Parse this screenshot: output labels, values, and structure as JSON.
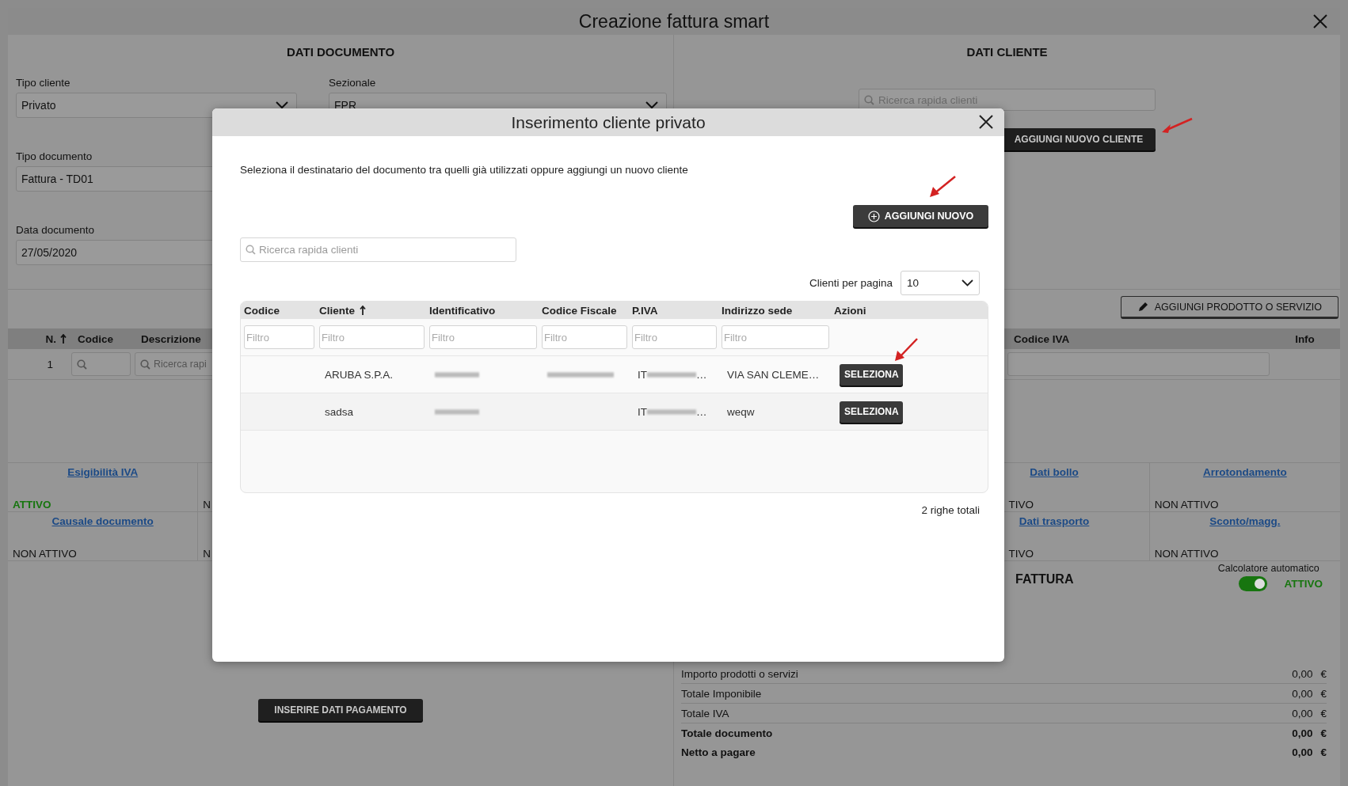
{
  "window": {
    "title": "Creazione fattura smart"
  },
  "documento": {
    "heading": "DATI DOCUMENTO",
    "fields": [
      {
        "label": "Tipo cliente",
        "value": "Privato",
        "kind": "select"
      },
      {
        "label": "Sezionale",
        "value": "FPR",
        "kind": "select"
      },
      {
        "label": "Tipo documento",
        "value": "Fattura - TD01",
        "kind": "text"
      },
      {
        "label": "Data documento",
        "value": "27/05/2020",
        "kind": "text"
      }
    ]
  },
  "cliente": {
    "heading": "DATI CLIENTE",
    "search_placeholder": "Ricerca rapida clienti",
    "add_button": "AGGIUNGI NUOVO CLIENTE"
  },
  "products": {
    "add_button": "AGGIUNGI PRODOTTO O SERVIZIO",
    "columns": [
      {
        "label": "N.",
        "sorted": true
      },
      {
        "label": "Codice",
        "sorted": false
      },
      {
        "label": "Descrizione",
        "sorted": false
      },
      {
        "label": "Codice IVA",
        "sorted": false
      },
      {
        "label": "Info",
        "sorted": false
      }
    ],
    "row": {
      "number": "1",
      "description_placeholder": "Ricerca rapi"
    }
  },
  "options": {
    "rows": [
      {
        "left": [
          {
            "label": "Esigibilità IVA",
            "status": "ATTIVO",
            "active": true
          },
          {
            "status": "N",
            "active": false
          }
        ],
        "right": [
          {
            "label": "Dati bollo",
            "status": "TIVO",
            "active": false
          },
          {
            "label": "Arrotondamento",
            "status": "NON ATTIVO",
            "active": false
          }
        ]
      },
      {
        "left": [
          {
            "label": "Causale documento",
            "status": "NON ATTIVO",
            "active": false
          },
          {
            "status": "N",
            "active": false
          }
        ],
        "right": [
          {
            "label": "Dati trasporto",
            "status": "TIVO",
            "active": false
          },
          {
            "label": "Sconto/magg.",
            "status": "NON ATTIVO",
            "active": false
          }
        ]
      }
    ]
  },
  "payment_button": "INSERIRE DATI PAGAMENTO",
  "summary": {
    "heading": "FATTURA",
    "auto_calculator": {
      "label": "Calcolatore automatico",
      "on": true,
      "status": "ATTIVO"
    },
    "rows": [
      {
        "label": "Importo prodotti o servizi",
        "value": "0,00",
        "currency": "€",
        "bold": false
      },
      {
        "label": "Totale Imponibile",
        "value": "0,00",
        "currency": "€",
        "bold": false
      },
      {
        "label": "Totale IVA",
        "value": "0,00",
        "currency": "€",
        "bold": false
      },
      {
        "label": "Totale documento",
        "value": "0,00",
        "currency": "€",
        "bold": true
      },
      {
        "label": "Netto a pagare",
        "value": "0,00",
        "currency": "€",
        "bold": true
      }
    ]
  },
  "modal": {
    "title": "Inserimento cliente privato",
    "intro": "Seleziona il destinatario del documento tra quelli già utilizzati oppure aggiungi un nuovo cliente",
    "add_button": "AGGIUNGI NUOVO",
    "search_placeholder": "Ricerca rapida clienti",
    "page_size_label": "Clienti per pagina",
    "page_size": "10",
    "columns": [
      {
        "label": "Codice",
        "sorted": false,
        "filter_placeholder": "Filtro"
      },
      {
        "label": "Cliente",
        "sorted": true,
        "filter_placeholder": "Filtro"
      },
      {
        "label": "Identificativo",
        "sorted": false,
        "filter_placeholder": "Filtro"
      },
      {
        "label": "Codice Fiscale",
        "sorted": false,
        "filter_placeholder": "Filtro"
      },
      {
        "label": "P.IVA",
        "sorted": false,
        "filter_placeholder": "Filtro"
      },
      {
        "label": "Indirizzo sede",
        "sorted": false,
        "filter_placeholder": "Filtro"
      },
      {
        "label": "Azioni",
        "sorted": false
      }
    ],
    "rows": [
      {
        "cliente": "ARUBA S.P.A.",
        "identificativo_hidden": true,
        "codice_fiscale_hidden": true,
        "piva_prefix": "IT",
        "piva_hidden": true,
        "piva_suffix": "…",
        "indirizzo": "VIA SAN CLEME…",
        "action": "SELEZIONA"
      },
      {
        "cliente": "sadsa",
        "identificativo_hidden": true,
        "codice_fiscale_hidden": false,
        "piva_prefix": "IT",
        "piva_hidden": true,
        "piva_suffix": "…",
        "indirizzo": "weqw",
        "action": "SELEZIONA"
      }
    ],
    "total": "2 righe totali"
  }
}
